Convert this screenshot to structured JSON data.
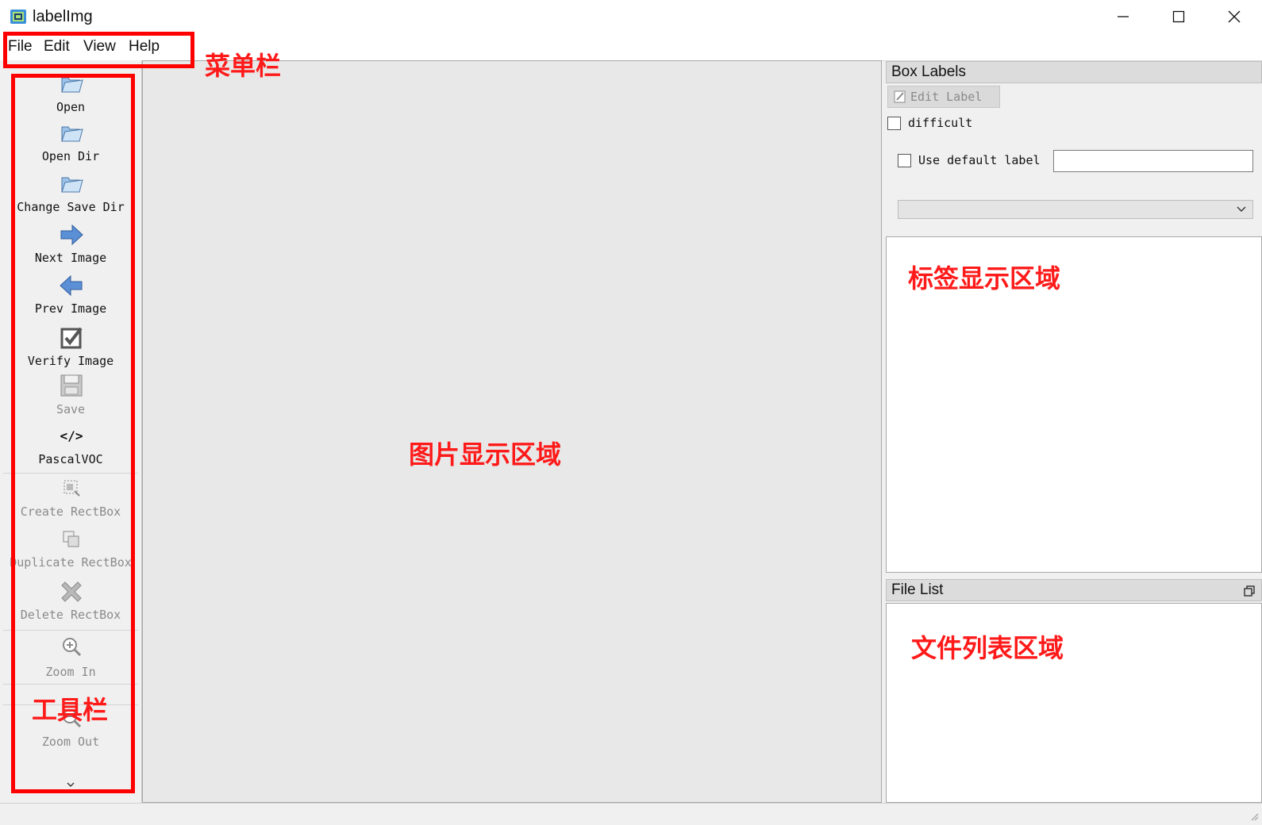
{
  "window": {
    "title": "labelImg",
    "controls": {
      "minimize": "minimize-icon",
      "maximize": "maximize-icon",
      "close": "close-icon"
    }
  },
  "menu": {
    "items": [
      {
        "label": "File"
      },
      {
        "label": "Edit"
      },
      {
        "label": "View"
      },
      {
        "label": "Help"
      }
    ]
  },
  "toolbar": {
    "tools": [
      {
        "label": "Open",
        "icon": "folder-open-icon",
        "enabled": true
      },
      {
        "label": "Open Dir",
        "icon": "folder-open-icon",
        "enabled": true
      },
      {
        "label": "Change Save Dir",
        "icon": "folder-open-icon",
        "enabled": true
      },
      {
        "label": "Next Image",
        "icon": "arrow-right-icon",
        "enabled": true
      },
      {
        "label": "Prev Image",
        "icon": "arrow-left-icon",
        "enabled": true
      },
      {
        "label": "Verify Image",
        "icon": "checkbox-check-icon",
        "enabled": true
      },
      {
        "label": "Save",
        "icon": "floppy-disk-icon",
        "enabled": false
      },
      {
        "label": "PascalVOC",
        "icon": "code-tag-icon",
        "enabled": true
      },
      {
        "label": "Create RectBox",
        "icon": "create-rect-icon",
        "enabled": false
      },
      {
        "label": "Duplicate RectBox",
        "icon": "duplicate-rect-icon",
        "enabled": false
      },
      {
        "label": "Delete RectBox",
        "icon": "delete-x-icon",
        "enabled": false
      },
      {
        "label": "Zoom In",
        "icon": "zoom-in-icon",
        "enabled": false
      },
      {
        "label": "Zoom Out",
        "icon": "zoom-out-icon",
        "enabled": false
      }
    ],
    "more_icon": "chevron-down-icon"
  },
  "box_labels": {
    "title": "Box Labels",
    "edit_label_button": "Edit Label",
    "difficult_label": "difficult",
    "difficult_checked": false,
    "use_default_label": "Use default label",
    "use_default_checked": false,
    "default_label_value": "",
    "dropdown_value": ""
  },
  "file_list": {
    "title": "File List",
    "float_icon": "restore-window-icon"
  },
  "annotations": {
    "menubar": "菜单栏",
    "toolbar": "工具栏",
    "canvas": "图片显示区域",
    "labels": "标签显示区域",
    "files": "文件列表区域"
  },
  "colors": {
    "annotation": "#ff0000",
    "canvas_bg": "#e8e8e8",
    "panel_bg": "#f0f0f0"
  }
}
